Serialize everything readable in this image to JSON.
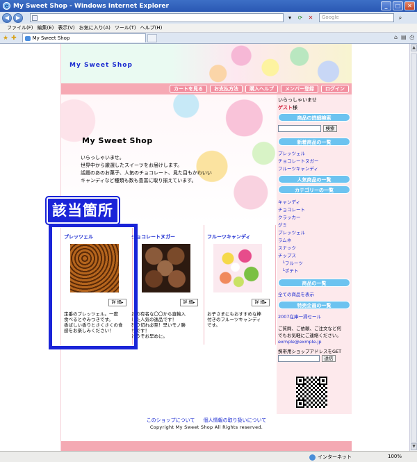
{
  "window": {
    "title": "My Sweet Shop - Windows Internet Explorer",
    "url_placeholder": "",
    "search_placeholder": "Google"
  },
  "menu": [
    "ファイル(F)",
    "編集(E)",
    "表示(V)",
    "お気に入り(A)",
    "ツール(T)",
    "ヘルプ(H)"
  ],
  "tab": {
    "label": "My Sweet Shop"
  },
  "status": {
    "zone": "インターネット",
    "zoom": "100%"
  },
  "header": {
    "title": "My Sweet Shop"
  },
  "nav": [
    "カートを見る",
    "お支払方法",
    "購入ヘルプ",
    "メンバー登録",
    "ログイン"
  ],
  "hero": {
    "title": "My Sweet Shop",
    "lines": [
      "いらっしゃいませ。",
      "世界中から厳選したスイーツをお届けします。",
      "話題のあのお菓子、人気のチョコレート、見た目もかわいい",
      "キャンディなど種類も数も豊富に取り揃えています。"
    ]
  },
  "products": [
    {
      "name": "プレッツェル",
      "detail": "詳 細▸",
      "desc": [
        "定番のプレッツェル。一度",
        "食べるとやみつきです。",
        "香ばしい香りとさくさくの食",
        "感をお楽しみください！"
      ]
    },
    {
      "name": "チョコレートヌガー",
      "detail": "詳 細▸",
      "desc": [
        "あの有名な〇〇から直輸入",
        "した人気の逸品です！",
        "売り切れ必至！早いモノ勝",
        "ちです！",
        "どうぞお早めに。"
      ]
    },
    {
      "name": "フルーツキャンディ",
      "detail": "詳 細▸",
      "desc": [
        "お子さまにもおすすめな棒",
        "付きのフルーツキャンディ",
        "です。"
      ]
    }
  ],
  "sidebar": {
    "greeting": "いらっしゃいませ",
    "guest": "ゲスト",
    "guest_suffix": "様",
    "search_head": "商品の詳細検索",
    "search_btn": "検索",
    "new_head": "新着商品の一覧",
    "new_items": [
      "プレッツェル",
      "チョコレートヌガー",
      "フルーツキャンディ"
    ],
    "popular_head": "人気商品の一覧",
    "category_head": "カテゴリーの一覧",
    "categories": [
      "キャンディ",
      "チョコレート",
      "クラッカー",
      "グミ",
      "プレッツェル",
      "ラムネ",
      "スナック",
      "チップス"
    ],
    "sub_categories": [
      "フルーツ",
      "ポテト"
    ],
    "all_head": "商品の一覧",
    "all_link": "全ての商品を表示",
    "special_head": "特売企画の一覧",
    "special_link": "2007在庫一掃セール",
    "contact": [
      "ご質問、ご依頼、ご注文など何",
      "でもお気軽にご連絡ください。"
    ],
    "email": "exmple@exmple.jp",
    "mobile_label": "携帯用ショップアドレスをGET",
    "send_btn": "送信"
  },
  "footer": {
    "links": [
      "このショップについて",
      "個人情報の取り扱いについて"
    ],
    "copyright": "Copyright My Sweet Shop All Rights reserved."
  },
  "annotation": {
    "label": "該当箇所"
  },
  "colors": {
    "accent_blue": "#1a24d8",
    "pink": "#f6a9b4",
    "sidebar_head": "#6cc3f0"
  }
}
